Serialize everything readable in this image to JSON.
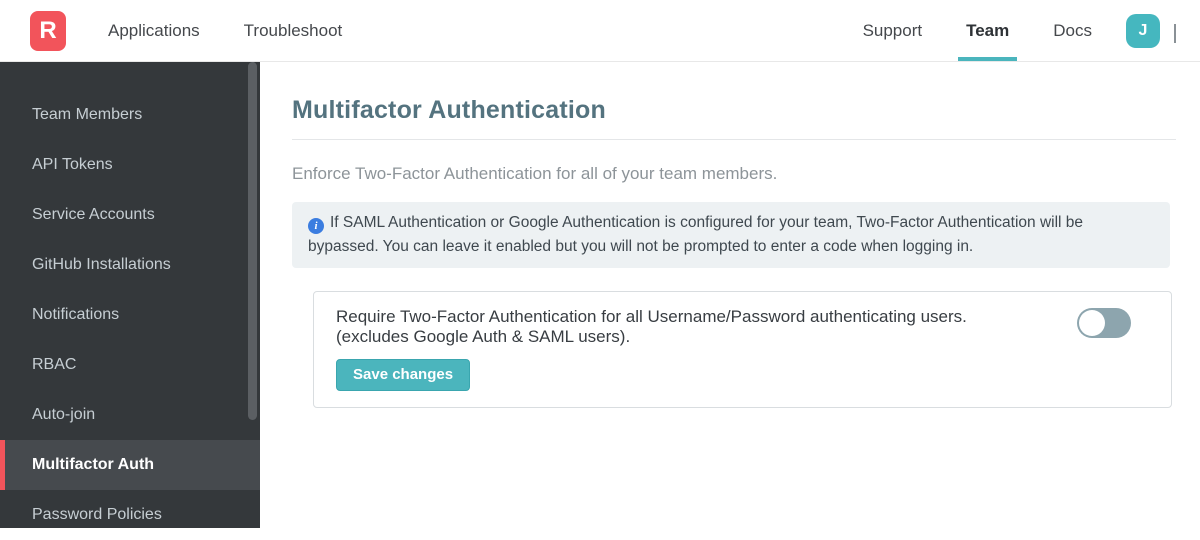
{
  "navbar": {
    "logo_letter": "R",
    "left_items": [
      {
        "label": "Applications"
      },
      {
        "label": "Troubleshoot"
      }
    ],
    "right_items": [
      {
        "label": "Support",
        "active": false
      },
      {
        "label": "Team",
        "active": true
      },
      {
        "label": "Docs",
        "active": false
      }
    ],
    "avatar_initial": "J"
  },
  "sidebar": {
    "items": [
      {
        "label": "Team Members",
        "active": false
      },
      {
        "label": "API Tokens",
        "active": false
      },
      {
        "label": "Service Accounts",
        "active": false
      },
      {
        "label": "GitHub Installations",
        "active": false
      },
      {
        "label": "Notifications",
        "active": false
      },
      {
        "label": "RBAC",
        "active": false
      },
      {
        "label": "Auto-join",
        "active": false
      },
      {
        "label": "Multifactor Auth",
        "active": true
      },
      {
        "label": "Password Policies",
        "active": false
      }
    ]
  },
  "main": {
    "title": "Multifactor Authentication",
    "subtitle": "Enforce Two-Factor Authentication for all of your team members.",
    "info_icon_glyph": "i",
    "info_note": "If SAML Authentication or Google Authentication is configured for your team, Two-Factor Authentication will be bypassed. You can leave it enabled but you will not be prompted to enter a code when logging in.",
    "setting": {
      "label_line1": "Require Two-Factor Authentication for all Username/Password authenticating users.",
      "label_line2": "(excludes Google Auth & SAML users).",
      "toggle_state": "off",
      "save_label": "Save changes"
    }
  },
  "colors": {
    "brand_red": "#f2545b",
    "accent_teal": "#4ab5bd",
    "sidebar_bg": "#34383b",
    "sidebar_active_bg": "#464a4e",
    "heading_color": "#54737f",
    "info_box_bg": "#edf1f3",
    "info_icon_blue": "#3b7de0",
    "toggle_off_track": "#8da5ae"
  }
}
